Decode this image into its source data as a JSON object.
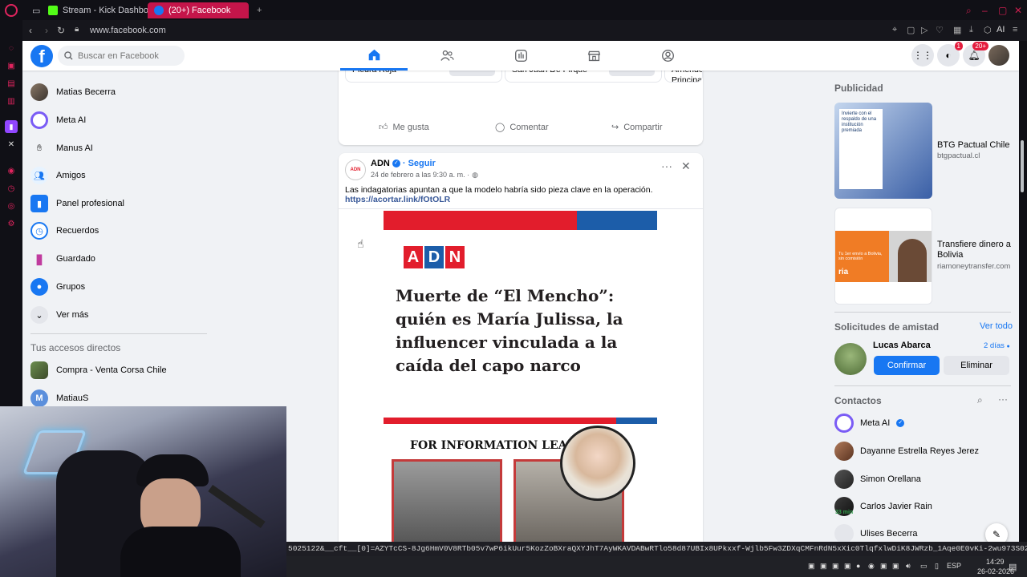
{
  "browser": {
    "tabs": [
      {
        "label": "Stream - Kick Dashboard"
      },
      {
        "label": "(20+) Facebook"
      }
    ],
    "url": "www.facebook.com",
    "ai_label": "AI"
  },
  "topnav": {
    "search_placeholder": "Buscar en Facebook",
    "messenger_badge": "1",
    "notif_badge": "20+"
  },
  "left_sidebar": {
    "items": [
      {
        "label": "Matias Becerra"
      },
      {
        "label": "Meta AI"
      },
      {
        "label": "Manus AI"
      },
      {
        "label": "Amigos"
      },
      {
        "label": "Panel profesional"
      },
      {
        "label": "Recuerdos"
      },
      {
        "label": "Guardado"
      },
      {
        "label": "Grupos"
      },
      {
        "label": "Ver más"
      }
    ],
    "shortcuts_title": "Tus accesos directos",
    "shortcuts": [
      {
        "label": "Compra - Venta Corsa Chile"
      },
      {
        "label": "MatiauS",
        "initial": "M"
      }
    ]
  },
  "marketplace": {
    "items": [
      {
        "title": "Casa En Arriendo En Piedra Roja",
        "button": "Comprar"
      },
      {
        "title": "Casa En Arriendo En San Juan De Pirque",
        "button": "Comprar"
      },
      {
        "title": "Casa En Arriendo Principal"
      }
    ],
    "actions": {
      "like": "Me gusta",
      "comment": "Comentar",
      "share": "Compartir"
    }
  },
  "post": {
    "author": "ADN",
    "follow": "· Seguir",
    "date": "24 de febrero a las 9:30 a. m. ·",
    "text": "Las indagatorias apuntan a que la modelo habría sido pieza clave en la operación.",
    "link": "https://acortar.link/fOtOLR",
    "image": {
      "logo": [
        "A",
        "D",
        "N"
      ],
      "headline": "Muerte de “El Mencho”: quién es María Julissa, la influencer vinculada a la caída del capo narco",
      "poster_text": "FOR INFORMATION LEA"
    }
  },
  "right_sidebar": {
    "ads_title": "Publicidad",
    "ads": [
      {
        "title": "BTG Pactual Chile",
        "domain": "btgpactual.cl",
        "image_text": "Invierte con el respaldo de una institución premiada"
      },
      {
        "title": "Transfiere dinero a Bolivia",
        "domain": "riamoneytransfer.com",
        "image_text": "Tu 1er envío a Bolivia, sin comisión",
        "brand": "ria"
      }
    ],
    "requests_title": "Solicitudes de amistad",
    "see_all": "Ver todo",
    "request": {
      "name": "Lucas Abarca",
      "time": "2 días",
      "confirm": "Confirmar",
      "delete": "Eliminar"
    },
    "contacts_title": "Contactos",
    "contacts": [
      {
        "name": "Meta AI"
      },
      {
        "name": "Dayanne Estrella Reyes Jerez"
      },
      {
        "name": "Simon Orellana"
      },
      {
        "name": "Carlos Javier Rain",
        "status": "33 min"
      },
      {
        "name": "Ulises Becerra"
      }
    ]
  },
  "status_url": "5025122&__cft__[0]=AZYTcCS-8Jg6HmV0V8RTb05v7wP6ikUur5KozZoBXraQXYJhT7AyWKAVDABwRTlo58d87UBIx8UPkxxf-Wjlb5Fw3ZDXqCMFnRdN5xXic0TlqfxlwDiK8JWRzb_1Aqe0E0vKi-2wu973S02C5woOzLgJxeF9Y...",
  "taskbar": {
    "lang": "ESP",
    "time": "14:29",
    "date": "26-02-2026"
  },
  "colors": {
    "fb_blue": "#1877f2",
    "tab_active": "#c4154a",
    "bg": "#f0f2f5"
  }
}
